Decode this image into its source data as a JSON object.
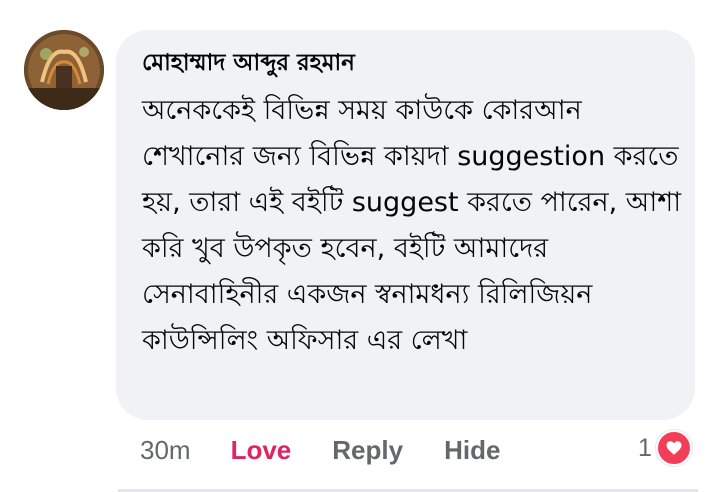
{
  "comment": {
    "author_name": "মোহাম্মাদ আব্দুর রহমান",
    "text": "অনেককেই বিভিন্ন সময় কাউকে কোরআন শেখানোর জন্য বিভিন্ন কায়দা suggestion করতে হয়, তারা এই বইটি suggest করতে পারেন, আশা করি খুব উপকৃত হবেন, বইটি আমাদের সেনাবাহিনীর একজন স্বনামধন্য রিলিজিয়ন কাউন্সিলিং অফিসার এর লেখা",
    "time": "30m",
    "actions": {
      "love": "Love",
      "reply": "Reply",
      "hide": "Hide"
    },
    "reaction_count": "1",
    "reaction_icon": "heart-icon"
  },
  "colors": {
    "bubble_bg": "#f0f2f5",
    "love_active": "#e0245e",
    "action_text": "#65676b",
    "heart_badge": "#f33e58"
  }
}
